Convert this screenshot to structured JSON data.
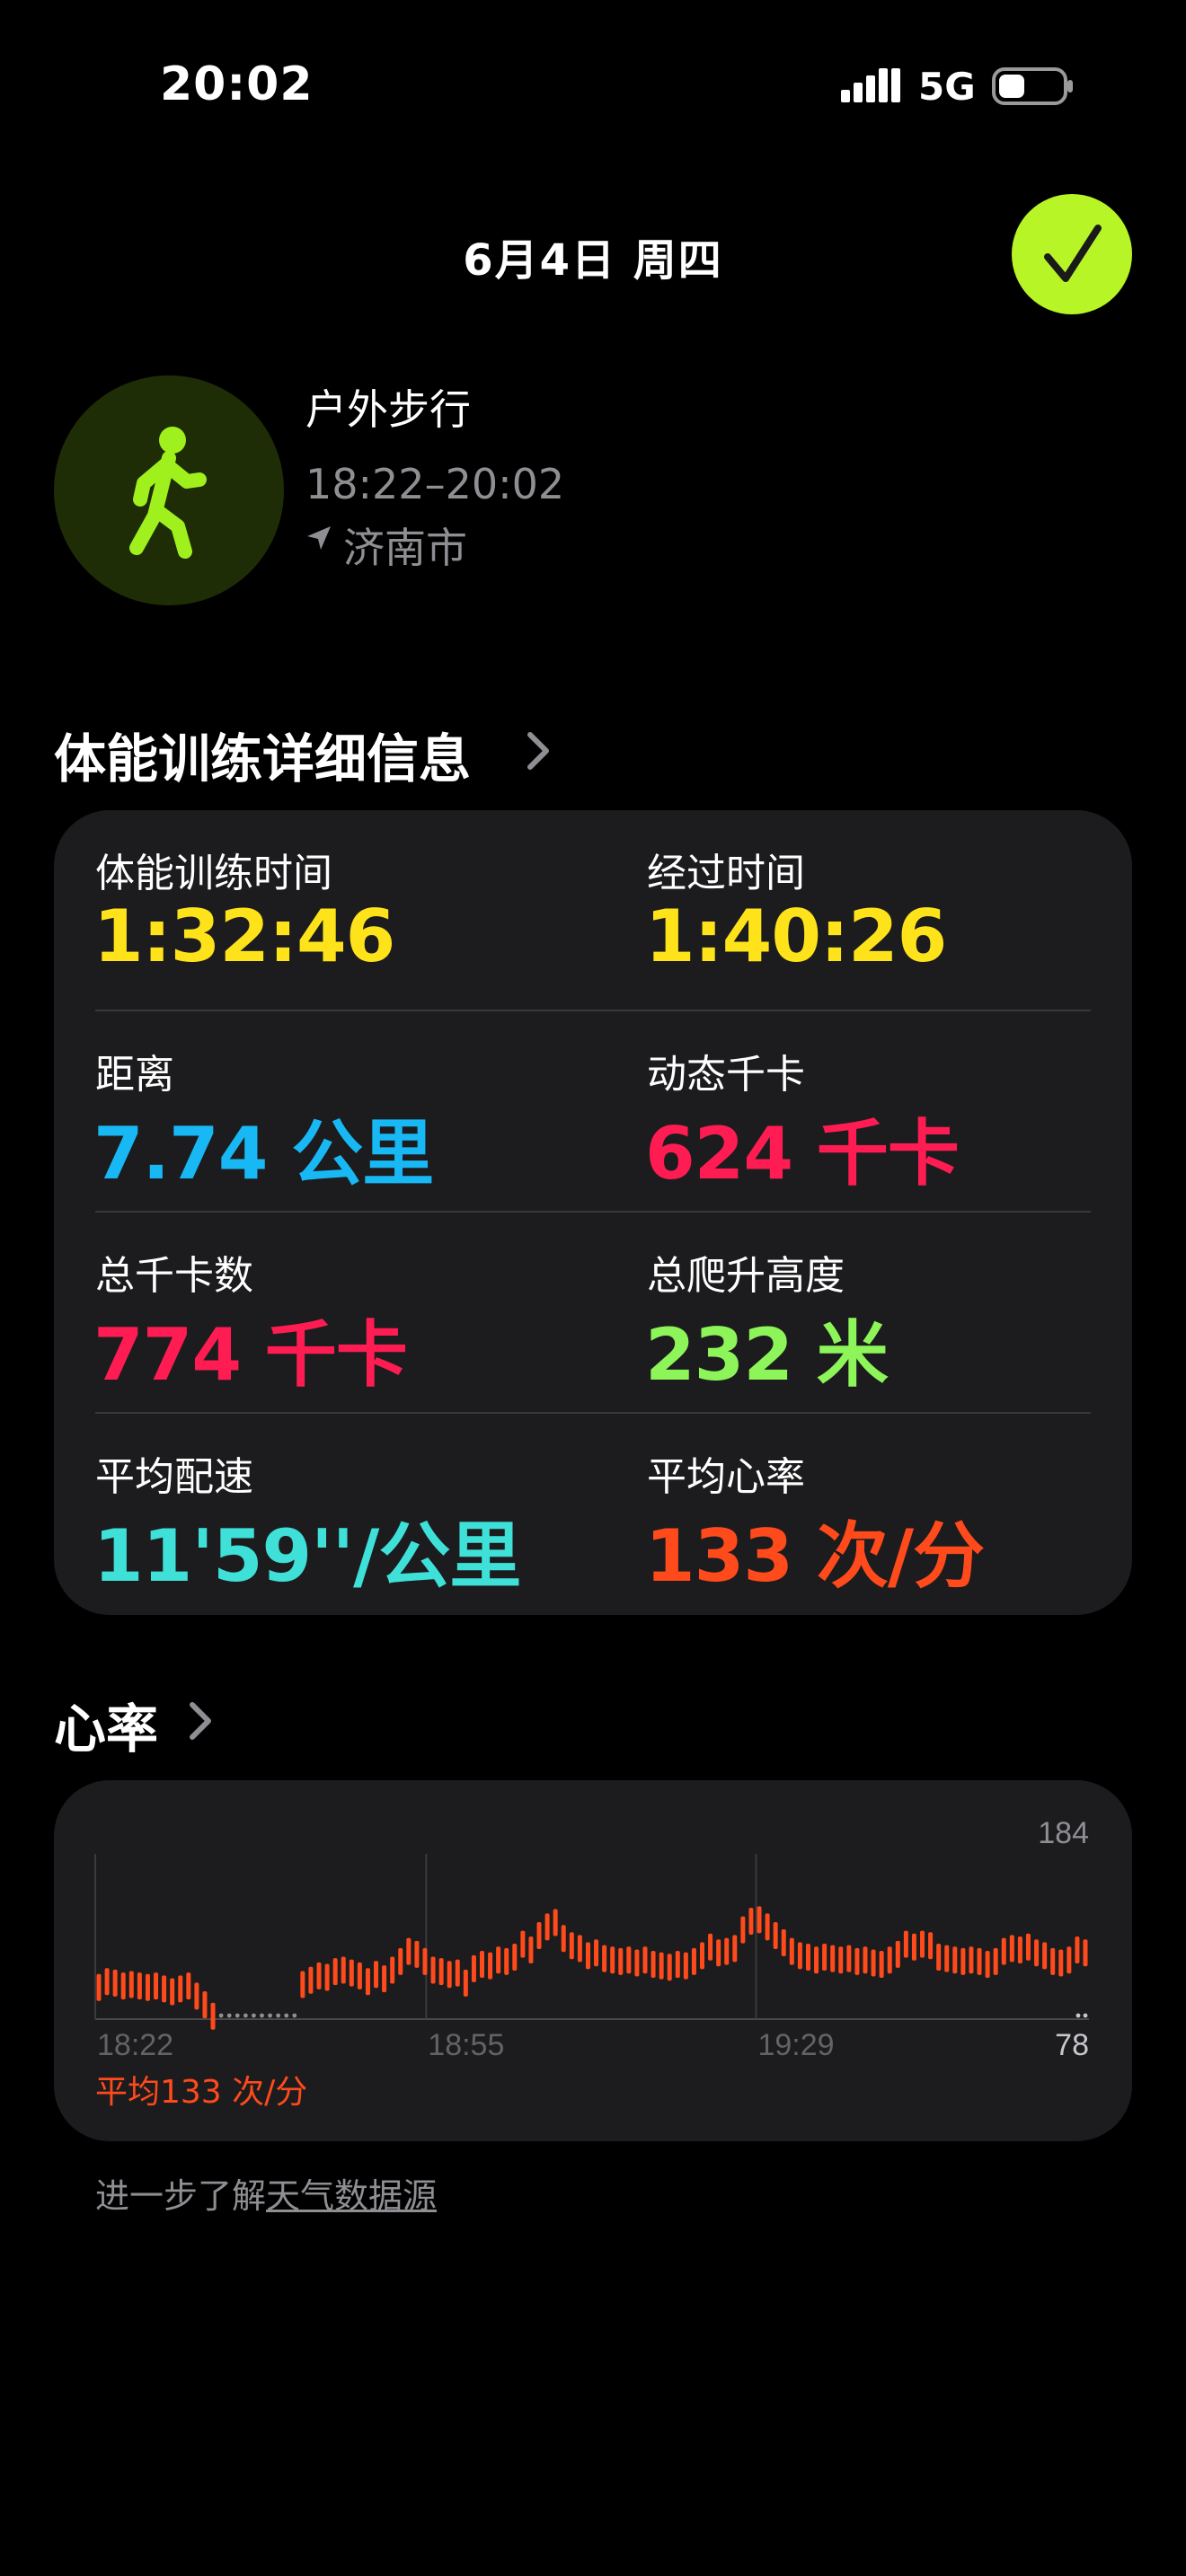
{
  "status_bar": {
    "time": "20:02",
    "network": "5G"
  },
  "header": {
    "date": "6月4日 周四"
  },
  "workout": {
    "name": "户外步行",
    "time_range": "18:22–20:02",
    "location": "济南市"
  },
  "details": {
    "title": "体能训练详细信息",
    "metrics": [
      {
        "label": "体能训练时间",
        "value": "1:32:46",
        "color": "#ffe31a"
      },
      {
        "label": "经过时间",
        "value": "1:40:26",
        "color": "#ffe31a"
      },
      {
        "label": "距离",
        "value": "7.74 公里",
        "color": "#18b8f5"
      },
      {
        "label": "动态千卡",
        "value": "624 千卡",
        "color": "#ff1c52"
      },
      {
        "label": "总千卡数",
        "value": "774 千卡",
        "color": "#ff1c52"
      },
      {
        "label": "总爬升高度",
        "value": "232 米",
        "color": "#8df55a"
      },
      {
        "label": "平均配速",
        "value": "11'59''/公里",
        "color": "#3ee0d8"
      },
      {
        "label": "平均心率",
        "value": "133 次/分",
        "color": "#ff4a1c"
      }
    ]
  },
  "heart_rate": {
    "title": "心率",
    "average": "平均133 次/分",
    "accent_color": "#ff4a1c"
  },
  "chart_data": {
    "type": "bar",
    "title": "",
    "y_max_label": "184",
    "y_min_label": "78",
    "ylim": [
      78,
      184
    ],
    "x_tick_labels": [
      "18:22",
      "18:55",
      "19:29"
    ],
    "grid": true,
    "series": [
      {
        "values": [
          100,
          104,
          103,
          101,
          102,
          101,
          100,
          101,
          99,
          97,
          99,
          101,
          94,
          88,
          80,
          null,
          null,
          null,
          null,
          null,
          null,
          null,
          null,
          null,
          null,
          102,
          105,
          108,
          107,
          111,
          112,
          110,
          108,
          104,
          109,
          106,
          112,
          118,
          125,
          123,
          118,
          112,
          111,
          109,
          110,
          103,
          113,
          116,
          115,
          119,
          118,
          121,
          130,
          126,
          136,
          142,
          145,
          134,
          129,
          127,
          122,
          124,
          120,
          119,
          118,
          119,
          117,
          119,
          116,
          115,
          114,
          116,
          115,
          118,
          122,
          128,
          124,
          125,
          127,
          140,
          146,
          147,
          142,
          136,
          131,
          125,
          122,
          121,
          119,
          121,
          120,
          119,
          120,
          118,
          119,
          117,
          116,
          119,
          123,
          130,
          128,
          130,
          129,
          121,
          120,
          119,
          118,
          119,
          118,
          116,
          118,
          125,
          127,
          126,
          128,
          124,
          122,
          118,
          117,
          119,
          126,
          124
        ]
      }
    ]
  },
  "footer": {
    "text": "进一步了解",
    "link": "天气数据源"
  }
}
